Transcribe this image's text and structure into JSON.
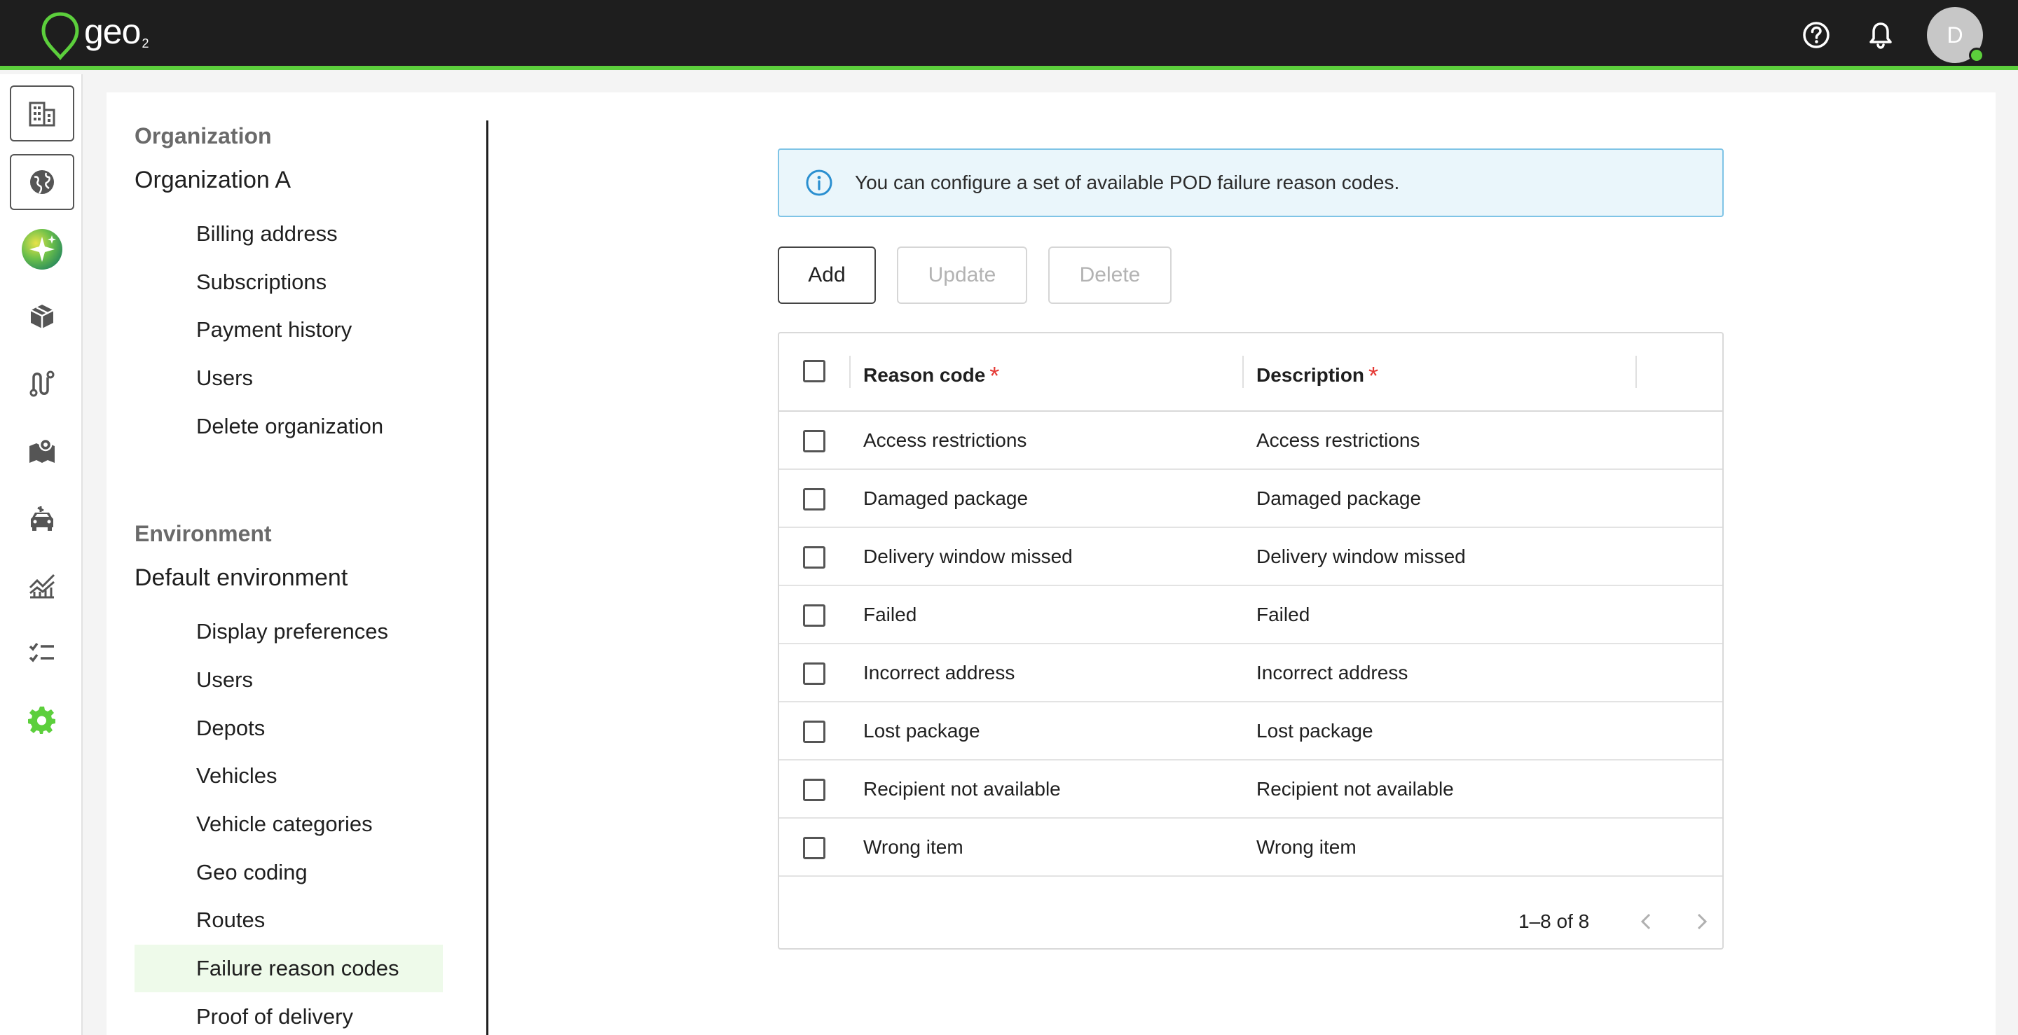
{
  "app": {
    "logo_text": "geo",
    "logo_sub": "2",
    "avatar_initial": "D",
    "accent_color": "#5ccf3c"
  },
  "topbar": {
    "icons": [
      "help-icon",
      "bell-icon"
    ]
  },
  "rail": {
    "items": [
      "building-icon",
      "globe-icon",
      "ai-assistant-icon",
      "package-icon",
      "route-icon",
      "map-icon",
      "vehicle-icon",
      "analytics-icon",
      "checklist-icon",
      "settings-icon"
    ]
  },
  "nav": {
    "org_heading": "Organization",
    "org_name": "Organization A",
    "org_items": [
      "Billing address",
      "Subscriptions",
      "Payment history",
      "Users",
      "Delete organization"
    ],
    "env_heading": "Environment",
    "env_name": "Default environment",
    "env_items": [
      "Display preferences",
      "Users",
      "Depots",
      "Vehicles",
      "Vehicle categories",
      "Geo coding",
      "Routes",
      "Failure reason codes",
      "Proof of delivery"
    ],
    "active_item": "Failure reason codes"
  },
  "alert": {
    "text": "You can configure a set of available POD failure reason codes."
  },
  "toolbar": {
    "add": "Add",
    "update": "Update",
    "delete": "Delete"
  },
  "table": {
    "columns": [
      "Reason code",
      "Description"
    ],
    "required_mark": "*",
    "rows": [
      {
        "code": "Access restrictions",
        "description": "Access restrictions"
      },
      {
        "code": "Damaged package",
        "description": "Damaged package"
      },
      {
        "code": "Delivery window missed",
        "description": "Delivery window missed"
      },
      {
        "code": "Failed",
        "description": "Failed"
      },
      {
        "code": "Incorrect address",
        "description": "Incorrect address"
      },
      {
        "code": "Lost package",
        "description": "Lost package"
      },
      {
        "code": "Recipient not available",
        "description": "Recipient not available"
      },
      {
        "code": "Wrong item",
        "description": "Wrong item"
      }
    ],
    "pagination": "1–8 of 8"
  }
}
